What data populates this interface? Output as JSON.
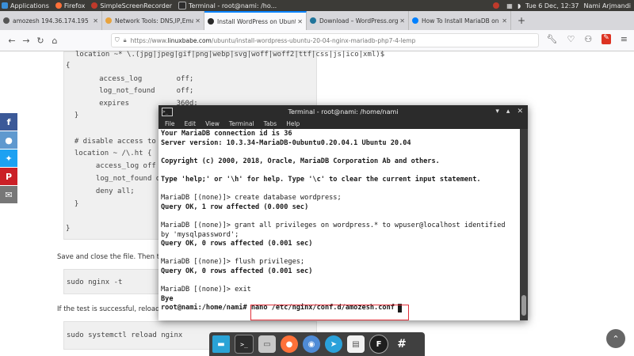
{
  "panel": {
    "applications": "Applications",
    "items": [
      "Firefox",
      "SimpleScreenRecorder",
      "Terminal - root@nami: /ho..."
    ],
    "datetime": "Tue 6 Dec, 12:37",
    "user": "Nami Arjmandi",
    "colors": {
      "firefox": "#ff7139",
      "recorder": "#c03a2b",
      "terminal": "#2d2d2d"
    }
  },
  "tabs": [
    {
      "label": "amozesh 194.36.174.195",
      "fav": "#555555"
    },
    {
      "label": "Network Tools: DNS,IP,Email",
      "fav": "#e8a33d"
    },
    {
      "label": "Install WordPress on Ubuntu",
      "fav": "#2a2a2a"
    },
    {
      "label": "Download – WordPress.org",
      "fav": "#21759b"
    },
    {
      "label": "How To Install MariaDB on",
      "fav": "#0080ff"
    }
  ],
  "toolbar": {
    "url_prefix": "https://www.",
    "url_domain": "linuxbabe.com",
    "url_path": "/ubuntu/install-wordpress-ubuntu-20-04-nginx-mariadb-php7-4-lemp"
  },
  "page": {
    "code1": [
      "location ~* \\.(jpg|jpeg|gif|png|webp|svg|woff|woff2|ttf|css|js|ico|xml)$",
      "{",
      "     access_log        off;",
      "     log_not_found     off;",
      "     expires           360d;",
      "  }",
      "",
      "  # disable access to",
      "  location ~ /\\.ht {",
      "       access_log off",
      "       log_not_found o",
      "       deny all;",
      "  }",
      "",
      "}"
    ],
    "para1": "Save and close the file. Then te",
    "code2": "sudo nginx -t",
    "para2": "If the test is successful, reload",
    "code3": "sudo systemctl reload nginx",
    "share": [
      {
        "label": "f",
        "color": "#3b5998",
        "icon": "facebook-icon"
      },
      {
        "label": "●",
        "color": "#5f99cf",
        "icon": "reddit-icon"
      },
      {
        "label": "✦",
        "color": "#1da1f2",
        "icon": "twitter-icon"
      },
      {
        "label": "P",
        "color": "#cb2027",
        "icon": "pinterest-icon"
      },
      {
        "label": "✉",
        "color": "#777777",
        "icon": "email-icon"
      }
    ]
  },
  "terminal": {
    "title": "Terminal - root@nami: /home/nami",
    "menu": [
      "File",
      "Edit",
      "View",
      "Terminal",
      "Tabs",
      "Help"
    ],
    "lines": [
      {
        "t": "Your MariaDB connection id is 36",
        "b": true
      },
      {
        "t": "Server version: 10.3.34-MariaDB-0ubuntu0.20.04.1 Ubuntu 20.04",
        "b": true
      },
      {
        "t": "",
        "b": false
      },
      {
        "t": "Copyright (c) 2000, 2018, Oracle, MariaDB Corporation Ab and others.",
        "b": true
      },
      {
        "t": "",
        "b": false
      },
      {
        "t": "Type 'help;' or '\\h' for help. Type '\\c' to clear the current input statement.",
        "b": true
      },
      {
        "t": "",
        "b": false
      },
      {
        "t": "MariaDB [(none)]> create database wordpress;",
        "b": false
      },
      {
        "t": "Query OK, 1 row affected (0.000 sec)",
        "b": true
      },
      {
        "t": "",
        "b": false
      },
      {
        "t": "MariaDB [(none)]> grant all privileges on wordpress.* to wpuser@localhost identified",
        "b": false
      },
      {
        "t": "by 'mysqlpassword';",
        "b": false
      },
      {
        "t": "Query OK, 0 rows affected (0.001 sec)",
        "b": true
      },
      {
        "t": "",
        "b": false
      },
      {
        "t": "MariaDB [(none)]> flush privileges;",
        "b": false
      },
      {
        "t": "Query OK, 0 rows affected (0.001 sec)",
        "b": true
      },
      {
        "t": "",
        "b": false
      },
      {
        "t": "MariaDB [(none)]> exit",
        "b": false
      },
      {
        "t": "Bye",
        "b": true
      },
      {
        "t": "root@nami:/home/nami# nano /etc/nginx/conf.d/amozesh.conf",
        "b": true
      }
    ],
    "highlight_color": "#e0303a"
  },
  "dock": [
    {
      "icon": "desktop-icon",
      "color": "#2aa3d6"
    },
    {
      "icon": "terminal-icon",
      "color": "#2d2d2d"
    },
    {
      "icon": "folder-icon",
      "color": "#c8c8c8"
    },
    {
      "icon": "firefox-icon",
      "color": "#ff7139"
    },
    {
      "icon": "chromium-icon",
      "color": "#4f8bd6"
    },
    {
      "icon": "telegram-icon",
      "color": "#2aa1da"
    },
    {
      "icon": "text-editor-icon",
      "color": "#f2f2f2"
    },
    {
      "icon": "f-app-icon",
      "color": "#1e1e1e"
    },
    {
      "icon": "hashtag-icon",
      "color": "#404040"
    }
  ]
}
